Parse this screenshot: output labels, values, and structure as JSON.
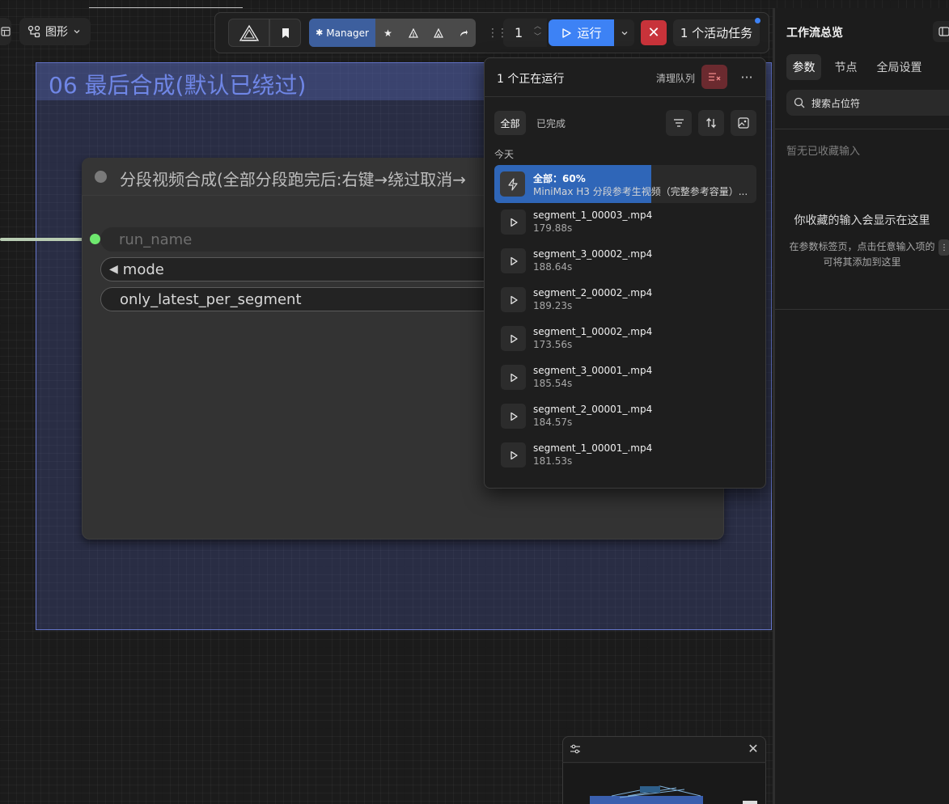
{
  "header": {
    "graph_label": "图形"
  },
  "group": {
    "title": "06 最后合成(默认已绕过)"
  },
  "node": {
    "title": "分段视频合成(全部分段跑完后:右键→绕过取消→",
    "widgets": {
      "run_name": "run_name",
      "mode": "mode",
      "only_latest": "only_latest_per_segment"
    }
  },
  "toolbar": {
    "manager_label": "Manager",
    "batch_count": "1",
    "run_label": "运行",
    "active_tasks": "1 个活动任务",
    "colors": {
      "run": "#3d82f5",
      "stop": "#c8333a",
      "manager": "#3d5f9e"
    }
  },
  "queue": {
    "title": "1 个正在运行",
    "clear_label": "清理队列",
    "tabs": {
      "all": "全部",
      "completed": "已完成"
    },
    "section_today": "今天",
    "running": {
      "label": "全部：60%",
      "progress": 0.6,
      "subtitle": "MiniMax H3 分段参考生视频（完整参考容量）..."
    },
    "items": [
      {
        "name": "segment_1_00003_.mp4",
        "time": "179.88s"
      },
      {
        "name": "segment_3_00002_.mp4",
        "time": "188.64s"
      },
      {
        "name": "segment_2_00002_.mp4",
        "time": "189.23s"
      },
      {
        "name": "segment_1_00002_.mp4",
        "time": "173.56s"
      },
      {
        "name": "segment_3_00001_.mp4",
        "time": "185.54s"
      },
      {
        "name": "segment_2_00001_.mp4",
        "time": "184.57s"
      },
      {
        "name": "segment_1_00001_.mp4",
        "time": "181.53s"
      }
    ]
  },
  "right_panel": {
    "title": "工作流总览",
    "tabs": [
      "参数",
      "节点",
      "全局设置"
    ],
    "search_placeholder": "搜索占位符",
    "empty_title": "暂无已收藏输入",
    "hint_title": "你收藏的输入会显示在这里",
    "hint_line1": "在参数标签页，点击任意输入项的",
    "hint_line2": "可将其添加到这里"
  }
}
